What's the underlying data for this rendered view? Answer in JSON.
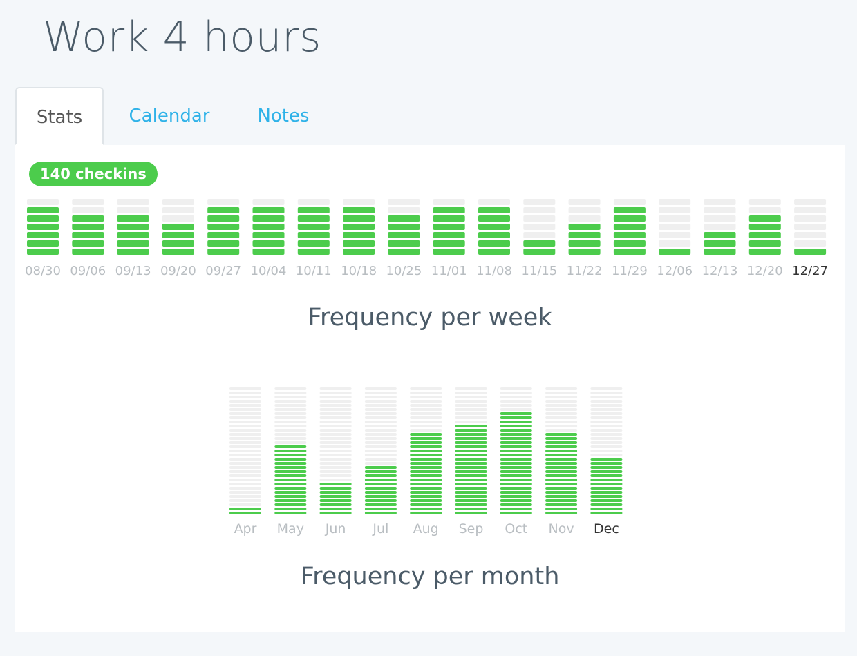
{
  "header": {
    "title": "Work 4 hours"
  },
  "tabs": [
    {
      "label": "Stats",
      "active": true
    },
    {
      "label": "Calendar",
      "active": false
    },
    {
      "label": "Notes",
      "active": false
    }
  ],
  "stats": {
    "checkins_badge": "140 checkins"
  },
  "colors": {
    "filled": "#4ccc4c",
    "empty": "#efefef",
    "label": "#b9bec2",
    "label_current": "#333333",
    "tab_link": "#2fb2e8"
  },
  "chart_data": [
    {
      "type": "bar",
      "title": "Frequency per week",
      "categories": [
        "08/30",
        "09/06",
        "09/13",
        "09/20",
        "09/27",
        "10/04",
        "10/11",
        "10/18",
        "10/25",
        "11/01",
        "11/08",
        "11/15",
        "11/22",
        "11/29",
        "12/06",
        "12/13",
        "12/20",
        "12/27"
      ],
      "values": [
        6,
        5,
        5,
        4,
        6,
        6,
        6,
        6,
        5,
        6,
        6,
        2,
        4,
        6,
        1,
        3,
        5,
        1
      ],
      "ylim": [
        0,
        7
      ],
      "highlight_category": "12/27"
    },
    {
      "type": "bar",
      "title": "Frequency per month",
      "categories": [
        "Apr",
        "May",
        "Jun",
        "Jul",
        "Aug",
        "Sep",
        "Oct",
        "Nov",
        "Dec"
      ],
      "values": [
        2,
        17,
        8,
        12,
        20,
        22,
        25,
        20,
        14
      ],
      "ylim": [
        0,
        31
      ],
      "highlight_category": "Dec"
    }
  ]
}
